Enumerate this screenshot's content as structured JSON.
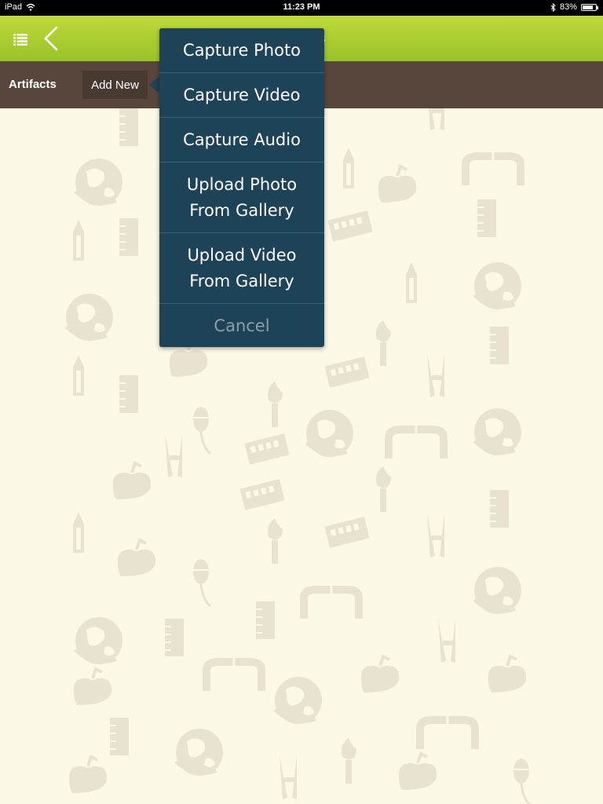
{
  "status_bar": {
    "device": "iPad",
    "time": "11:23 PM",
    "battery_text": "83%",
    "battery_level": 0.83,
    "icons": [
      "wifi-icon",
      "bluetooth-icon",
      "battery-icon"
    ]
  },
  "header": {
    "title": "Artifacts",
    "menu_icon": "list-menu-icon",
    "back_icon": "back-chevron-icon",
    "colors": {
      "top": "#c0d83a",
      "bottom": "#98c32a"
    }
  },
  "toolbar": {
    "section_label": "Artifacts",
    "add_new_label": "Add New",
    "color": "#58463c"
  },
  "popover": {
    "color": "#1e4256",
    "items": [
      {
        "label": "Capture Photo"
      },
      {
        "label": "Capture Video"
      },
      {
        "label": "Capture Audio"
      },
      {
        "label_line1": "Upload Photo",
        "label_line2": "From Gallery"
      },
      {
        "label_line1": "Upload Video",
        "label_line2": "From Gallery"
      }
    ],
    "cancel_label": "Cancel"
  },
  "background": {
    "color": "#fcf8e6",
    "pattern_icons": [
      "globe-icon",
      "ruler-icon",
      "pencil-icon",
      "apple-icon",
      "abacus-icon",
      "mouse-icon",
      "compass-icon",
      "magnet-icon",
      "torch-icon"
    ]
  }
}
